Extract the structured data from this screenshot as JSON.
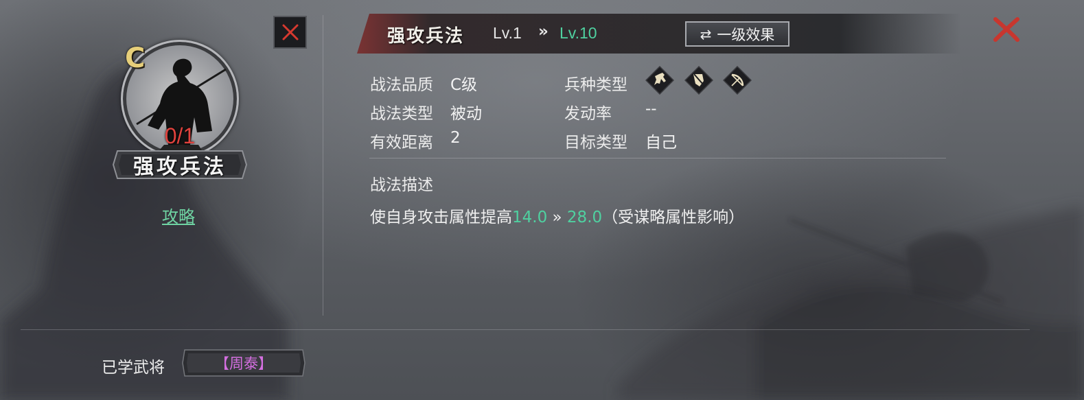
{
  "tactic": {
    "grade_badge": "C",
    "count": "0/1",
    "name": "强攻兵法",
    "guide_label": "攻略"
  },
  "header": {
    "title": "强攻兵法",
    "level_from": "Lv.1",
    "level_arrow": "»",
    "level_to": "Lv.10",
    "effect_button_label": "一级效果",
    "effect_button_icon": "swap-arrows-icon"
  },
  "info": {
    "quality_label": "战法品质",
    "quality_value": "C级",
    "type_label": "战法类型",
    "type_value": "被动",
    "range_label": "有效距离",
    "range_value": "2",
    "troop_label": "兵种类型",
    "troop_icons": [
      "cavalry-icon",
      "shield-icon",
      "bow-icon"
    ],
    "rate_label": "发动率",
    "rate_value": "--",
    "target_label": "目标类型",
    "target_value": "自己"
  },
  "description": {
    "title": "战法描述",
    "prefix": "使自身攻击属性提高",
    "value_from": "14.0",
    "arrow": " » ",
    "value_to": "28.0",
    "suffix": "（受谋略属性影响）"
  },
  "learned": {
    "label": "已学武将",
    "general": "【周泰】"
  },
  "colors": {
    "accent_green": "#4fd1a0",
    "close_red": "#d6392f",
    "count_red": "#e0423d",
    "grade_gold": "#e7cf7a",
    "general_purple": "#d46fe0"
  }
}
